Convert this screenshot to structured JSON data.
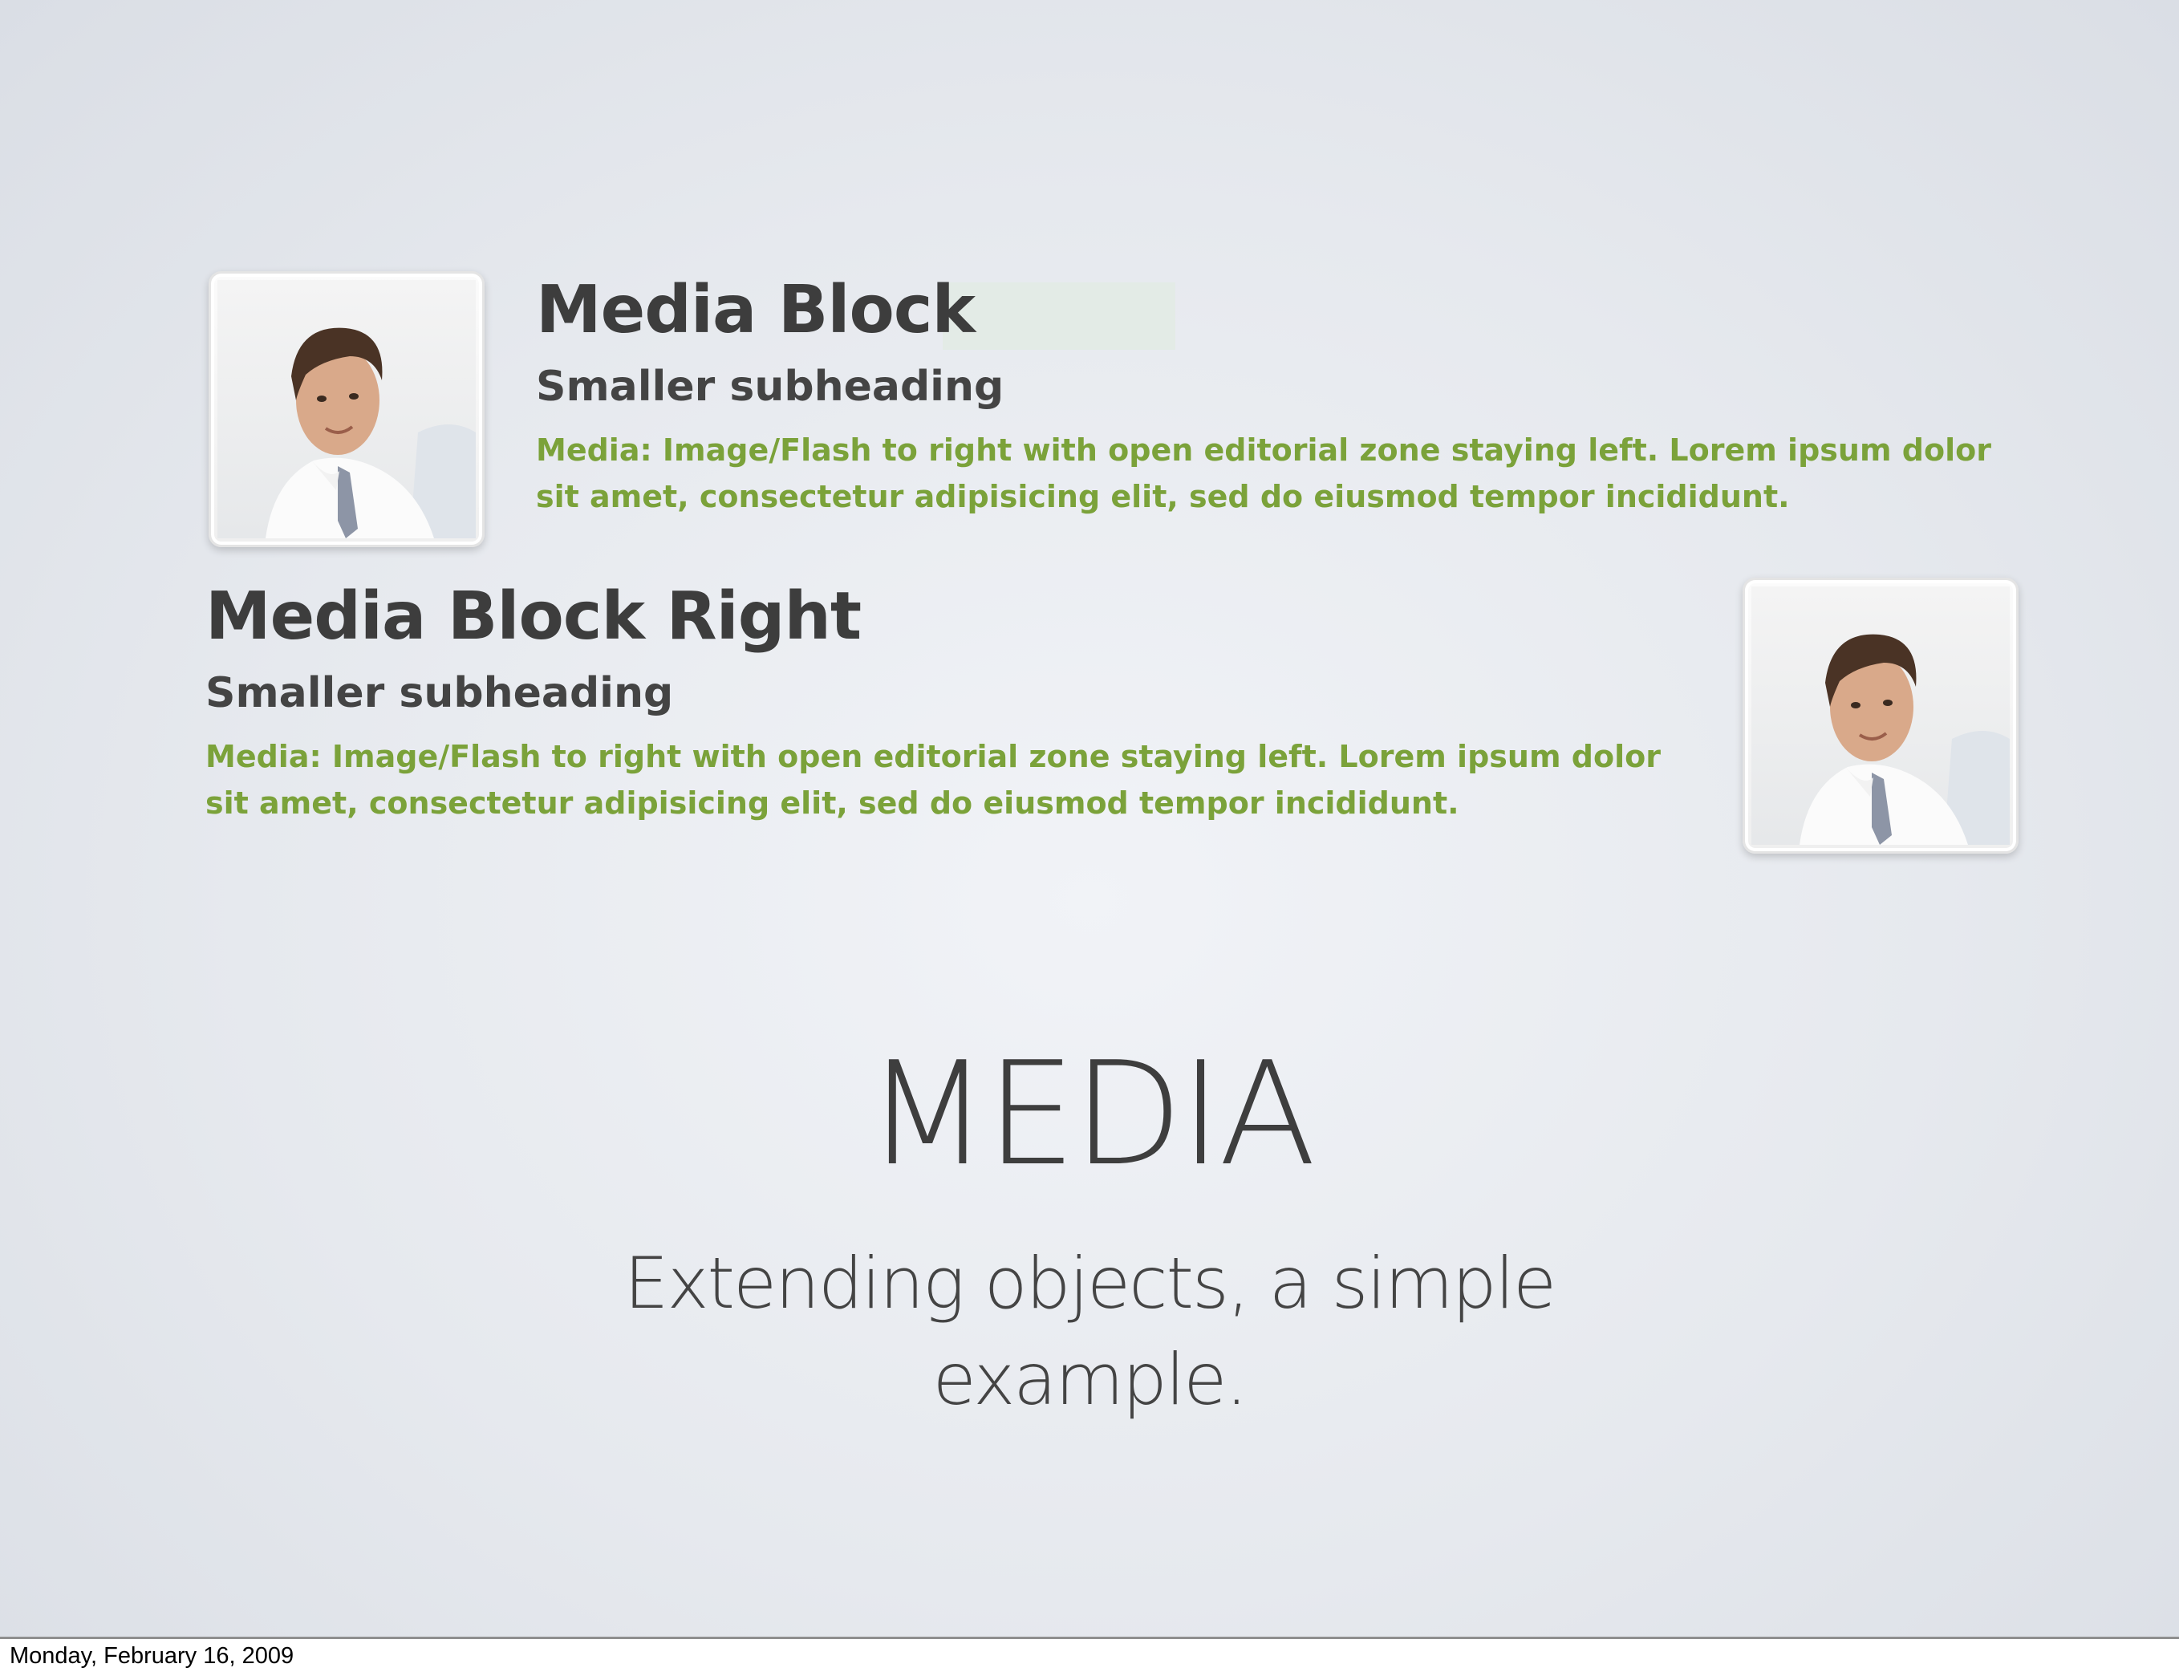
{
  "media_block": {
    "title": "Media Block",
    "subheading": "Smaller subheading",
    "body": "Media: Image/Flash to right with open editorial zone staying left. Lorem ipsum dolor sit amet, consectetur adipisicing elit, sed do eiusmod tempor incididunt."
  },
  "media_block_right": {
    "title": "Media Block Right",
    "subheading": "Smaller subheading",
    "body": "Media: Image/Flash to right with open editorial zone staying left. Lorem ipsum dolor sit amet, consectetur adipisicing elit, sed do eiusmod tempor incididunt."
  },
  "slide": {
    "title": "MEDIA",
    "subtitle_line1": "Extending objects, a simple",
    "subtitle_line2": "example."
  },
  "footer": {
    "date": "Monday, February 16, 2009"
  },
  "colors": {
    "body_text_green": "#7ba23a",
    "heading_gray": "#3d3d3d"
  }
}
